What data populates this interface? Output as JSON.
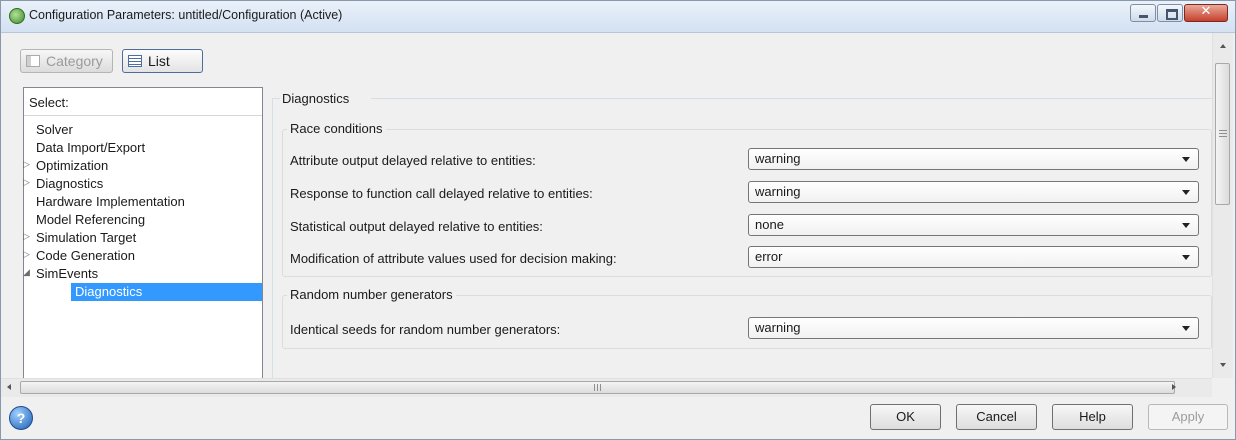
{
  "window": {
    "title": "Configuration Parameters: untitled/Configuration (Active)",
    "controls": [
      "minimize",
      "maximize",
      "close"
    ]
  },
  "toolbar": {
    "category_label": "Category",
    "category_enabled": false,
    "list_label": "List"
  },
  "select_panel": {
    "header": "Select:",
    "items": [
      {
        "label": "Solver",
        "expander": "",
        "selected": false
      },
      {
        "label": "Data Import/Export",
        "expander": "",
        "selected": false
      },
      {
        "label": "Optimization",
        "expander": "▷",
        "selected": false
      },
      {
        "label": "Diagnostics",
        "expander": "▷",
        "selected": false
      },
      {
        "label": "Hardware Implementation",
        "expander": "",
        "selected": false
      },
      {
        "label": "Model Referencing",
        "expander": "",
        "selected": false
      },
      {
        "label": "Simulation Target",
        "expander": "▷",
        "selected": false
      },
      {
        "label": "Code Generation",
        "expander": "▷",
        "selected": false
      },
      {
        "label": "SimEvents",
        "expander": "◢",
        "selected": false
      },
      {
        "label": "Diagnostics",
        "expander": "",
        "selected": true
      }
    ]
  },
  "main": {
    "section_title": "Diagnostics",
    "race_conditions": {
      "title": "Race conditions",
      "rows": [
        {
          "label": "Attribute output delayed relative to entities:",
          "value": "warning"
        },
        {
          "label": "Response to function call delayed relative to entities:",
          "value": "warning"
        },
        {
          "label": "Statistical output delayed relative to entities:",
          "value": "none"
        },
        {
          "label": "Modification of attribute values used for decision making:",
          "value": "error"
        }
      ]
    },
    "random_generators": {
      "title": "Random number generators",
      "rows": [
        {
          "label": "Identical seeds for random number generators:",
          "value": "warning"
        }
      ]
    }
  },
  "buttons": {
    "ok": "OK",
    "cancel": "Cancel",
    "help": "Help",
    "apply": "Apply",
    "apply_enabled": false
  },
  "colors": {
    "selection": "#3399ff",
    "window_bg": "#f0f0f0",
    "close_button": "#c6402c"
  }
}
